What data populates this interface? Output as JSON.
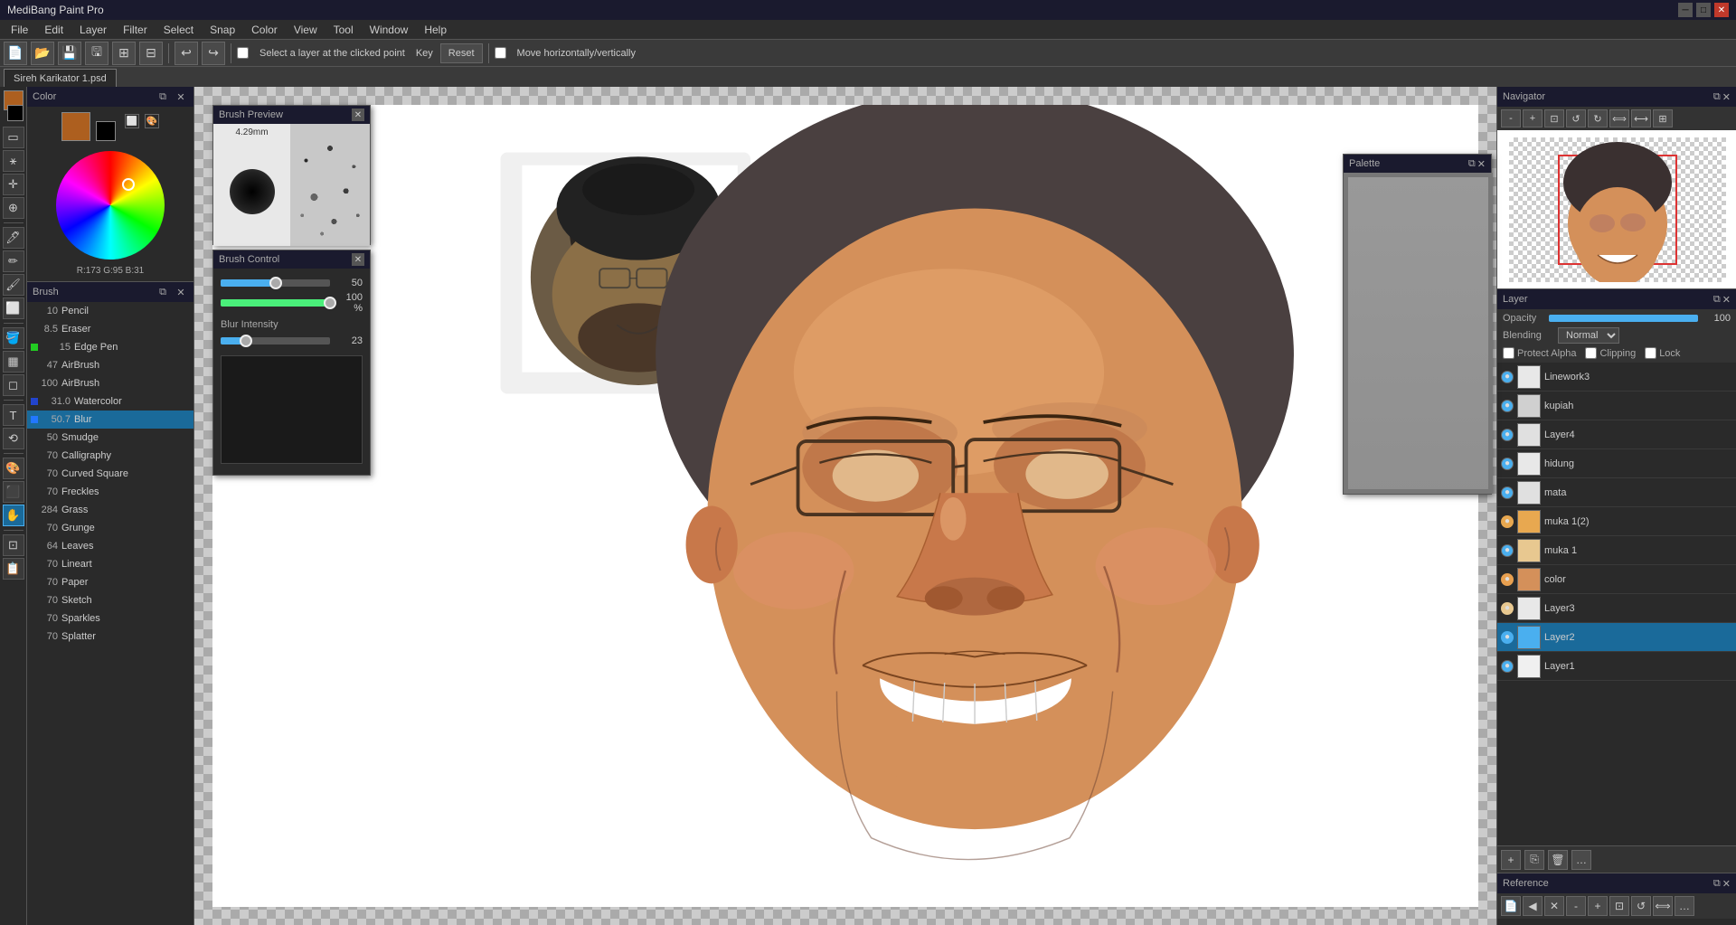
{
  "app": {
    "title": "MediBang Paint Pro",
    "file_title": "Sireh Karikator 1.psd"
  },
  "menubar": {
    "items": [
      "File",
      "Edit",
      "Layer",
      "Filter",
      "Select",
      "Snap",
      "Color",
      "View",
      "Tool",
      "Window",
      "Help"
    ]
  },
  "toolbar": {
    "checkbox_label": "Select a layer at the clicked point",
    "key_label": "Key",
    "reset_label": "Reset",
    "move_label": "Move horizontally/vertically"
  },
  "color_panel": {
    "title": "Color",
    "r": "173",
    "g": "95",
    "b": "31",
    "fg_color": "#ad5f1f",
    "bg_color": "#000000"
  },
  "brush_panel": {
    "title": "Brush",
    "items": [
      {
        "num": "10",
        "name": "Pencil",
        "color": null
      },
      {
        "num": "8.5",
        "name": "Eraser",
        "color": null
      },
      {
        "num": "15",
        "name": "Edge Pen",
        "color": "#22cc22"
      },
      {
        "num": "47",
        "name": "AirBrush",
        "color": null
      },
      {
        "num": "100",
        "name": "AirBrush",
        "color": null
      },
      {
        "num": "31.0",
        "name": "Watercolor",
        "color": "#2244cc"
      },
      {
        "num": "50.7",
        "name": "Blur",
        "color": "#2277ff",
        "active": true
      },
      {
        "num": "50",
        "name": "Smudge",
        "color": null
      },
      {
        "num": "70",
        "name": "Calligraphy",
        "color": null
      },
      {
        "num": "70",
        "name": "Curved Square",
        "color": null
      },
      {
        "num": "70",
        "name": "Freckles",
        "color": null
      },
      {
        "num": "284",
        "name": "Grass",
        "color": null
      },
      {
        "num": "70",
        "name": "Grunge",
        "color": null
      },
      {
        "num": "64",
        "name": "Leaves",
        "color": null
      },
      {
        "num": "70",
        "name": "Lineart",
        "color": null
      },
      {
        "num": "70",
        "name": "Paper",
        "color": null
      },
      {
        "num": "70",
        "name": "Sketch",
        "color": null
      },
      {
        "num": "70",
        "name": "Sparkles",
        "color": null
      },
      {
        "num": "70",
        "name": "Splatter",
        "color": null
      }
    ]
  },
  "brush_preview": {
    "title": "Brush Preview",
    "size": "4.29mm"
  },
  "brush_control": {
    "title": "Brush Control",
    "size_val": "50",
    "opacity_val": "100 %",
    "blur_label": "Blur Intensity",
    "blur_val": "23"
  },
  "navigator": {
    "title": "Navigator"
  },
  "layer_panel": {
    "title": "Layer",
    "opacity_label": "Opacity",
    "opacity_val": "100",
    "blending_label": "Blending",
    "blending_val": "Normal",
    "protect_alpha": "Protect Alpha",
    "clipping": "Clipping",
    "lock": "Lock",
    "layers": [
      {
        "name": "Linework3",
        "visible": true,
        "active": false
      },
      {
        "name": "kupiah",
        "visible": true,
        "active": false
      },
      {
        "name": "Layer4",
        "visible": true,
        "active": false
      },
      {
        "name": "hidung",
        "visible": true,
        "active": false
      },
      {
        "name": "mata",
        "visible": true,
        "active": false
      },
      {
        "name": "muka 1(2)",
        "visible": true,
        "active": false
      },
      {
        "name": "muka 1",
        "visible": true,
        "active": false
      },
      {
        "name": "color",
        "visible": true,
        "active": false
      },
      {
        "name": "Layer3",
        "visible": true,
        "active": false
      },
      {
        "name": "Layer2",
        "visible": true,
        "active": true
      },
      {
        "name": "Layer1",
        "visible": true,
        "active": false
      }
    ]
  },
  "palette": {
    "title": "Palette"
  },
  "reference": {
    "title": "Reference"
  }
}
